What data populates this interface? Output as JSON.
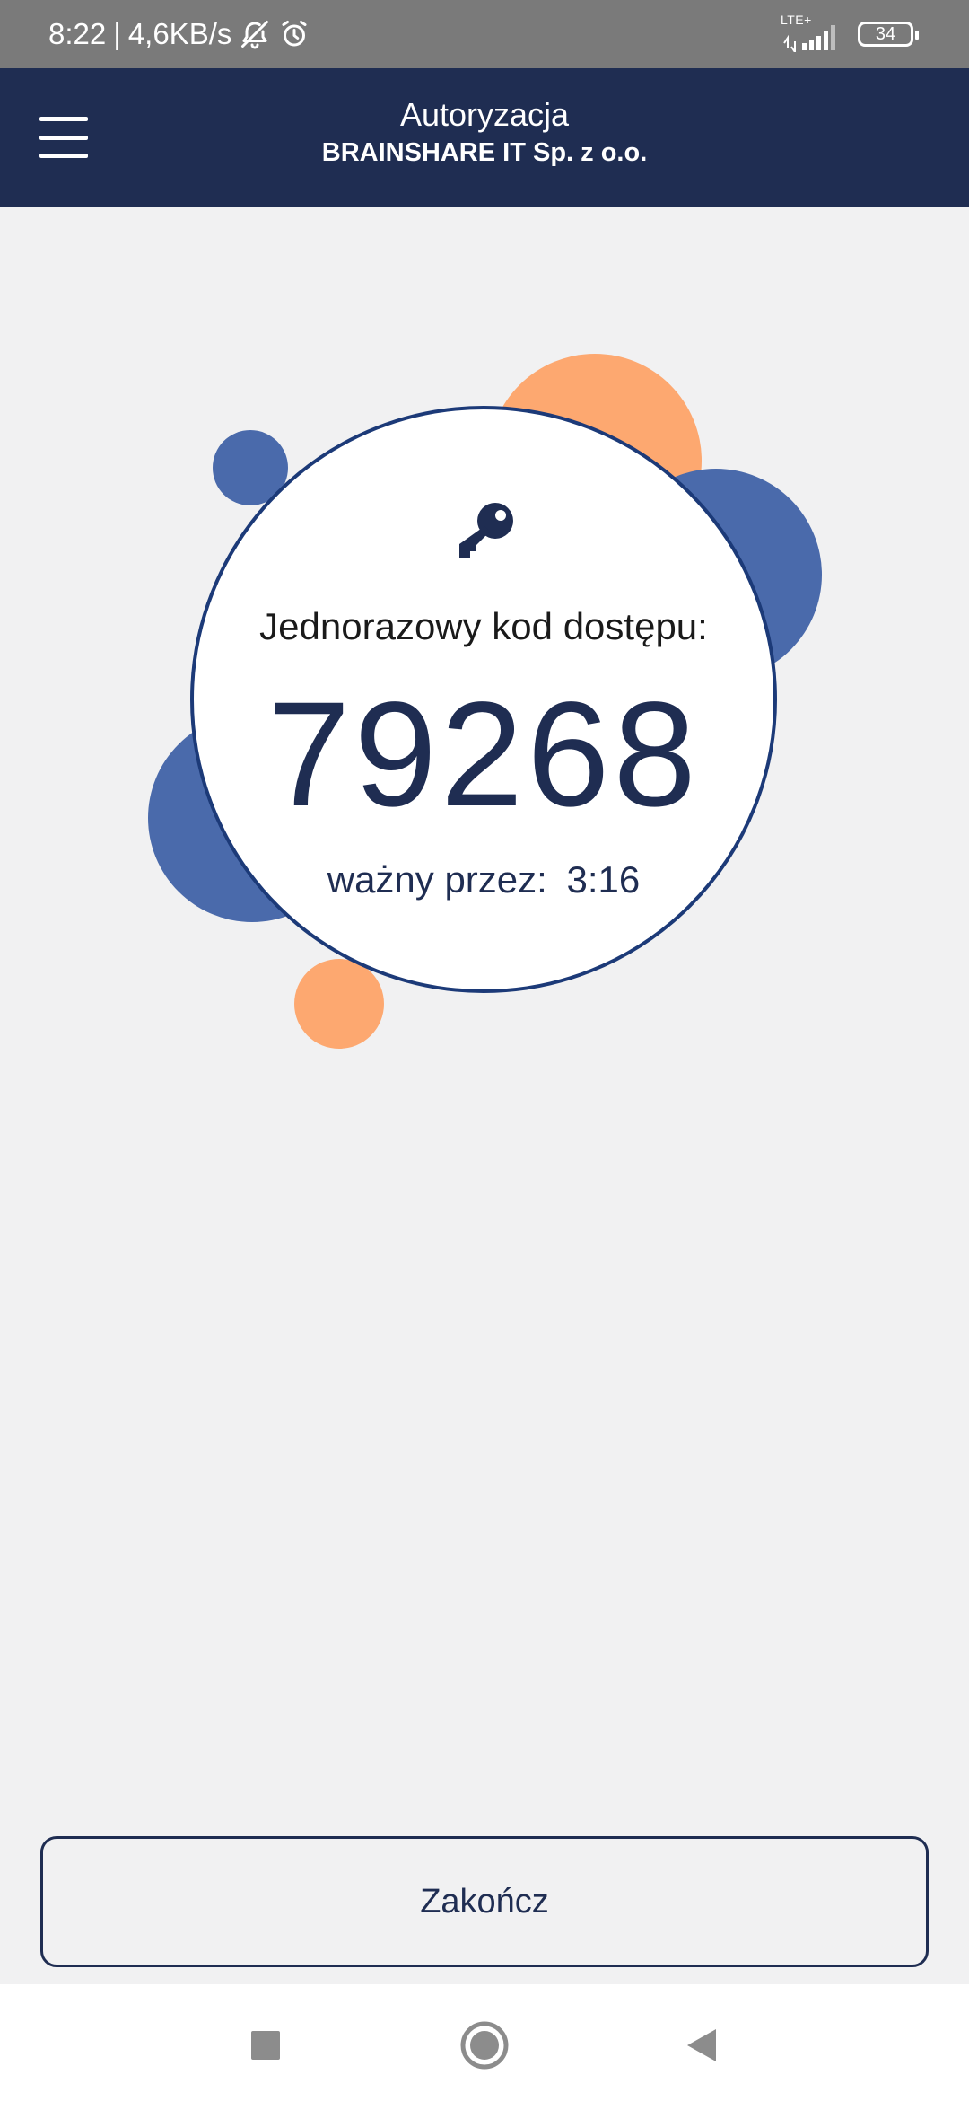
{
  "status_bar": {
    "time": "8:22",
    "separator": "|",
    "net_speed": "4,6KB/s",
    "network_type": "LTE+",
    "battery_level": "34",
    "icons": [
      "bell-off-icon",
      "alarm-icon",
      "signal-icon",
      "battery-icon"
    ]
  },
  "header": {
    "title": "Autoryzacja",
    "subtitle": "BRAINSHARE IT Sp. z o.o."
  },
  "code_card": {
    "icon": "key-icon",
    "label": "Jednorazowy kod dostępu:",
    "code": "79268",
    "validity_label": "ważny przez:",
    "validity_time": "3:16"
  },
  "actions": {
    "finish_label": "Zakończ"
  },
  "colors": {
    "header_bg": "#1f2d52",
    "accent_blue": "#4a6aab",
    "accent_orange": "#fda870",
    "background": "#f1f1f2"
  },
  "nav_bar": {
    "icons": [
      "recents-icon",
      "home-icon",
      "back-icon"
    ]
  }
}
